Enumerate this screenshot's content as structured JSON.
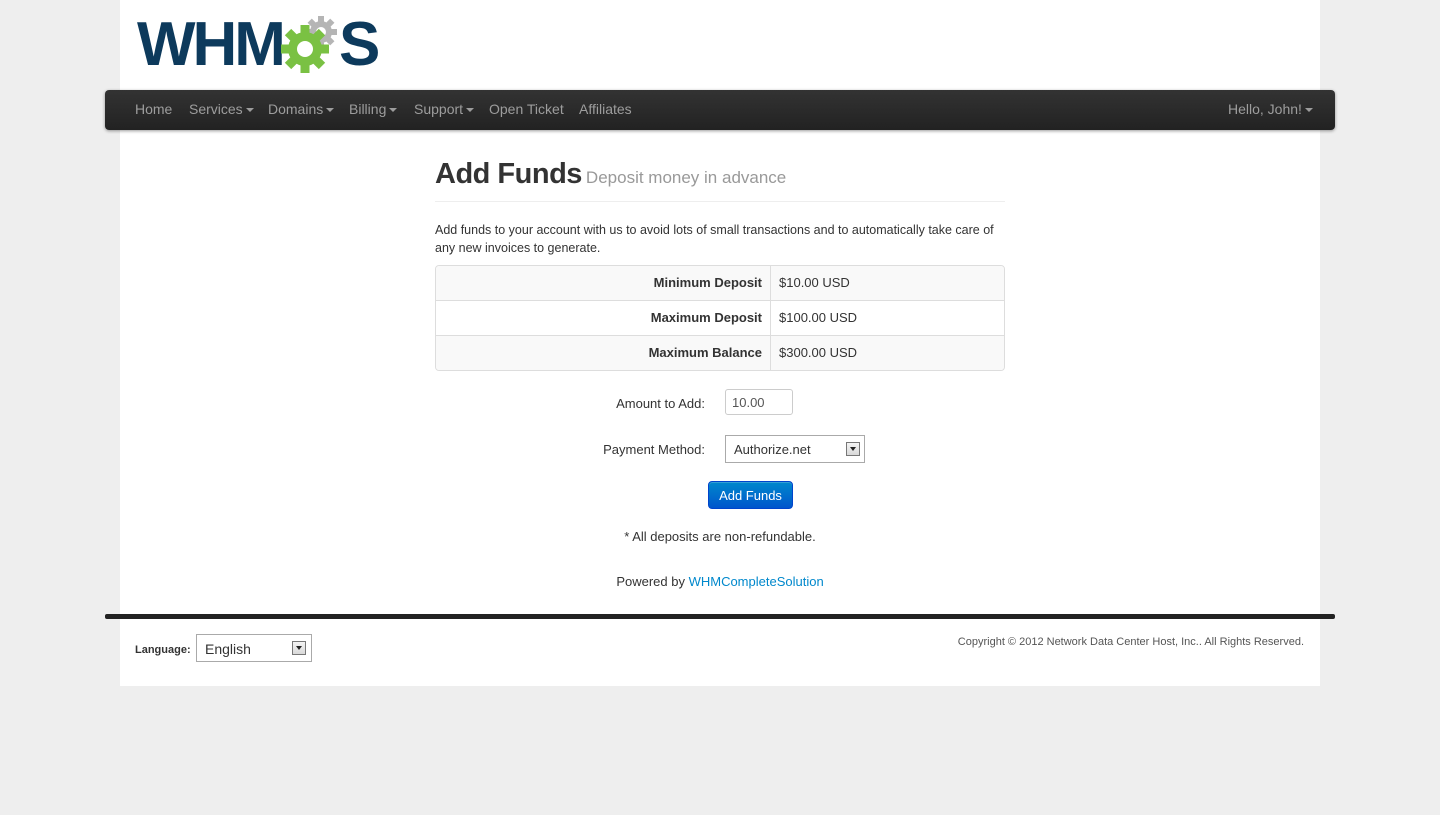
{
  "logo": {
    "text_before": "WHM",
    "text_after": "S",
    "alt": "WHMCS"
  },
  "nav": {
    "items": [
      {
        "label": "Home",
        "dropdown": false
      },
      {
        "label": "Services",
        "dropdown": true
      },
      {
        "label": "Domains",
        "dropdown": true
      },
      {
        "label": "Billing",
        "dropdown": true
      },
      {
        "label": "Support",
        "dropdown": true
      },
      {
        "label": "Open Ticket",
        "dropdown": false
      },
      {
        "label": "Affiliates",
        "dropdown": false
      }
    ],
    "user_menu": "Hello, John!"
  },
  "header": {
    "title": "Add Funds",
    "subtitle": "Deposit money in advance"
  },
  "intro": "Add funds to your account with us to avoid lots of small transactions and to automatically take care of any new invoices to generate.",
  "limits": [
    {
      "label": "Minimum Deposit",
      "value": "$10.00 USD"
    },
    {
      "label": "Maximum Deposit",
      "value": "$100.00 USD"
    },
    {
      "label": "Maximum Balance",
      "value": "$300.00 USD"
    }
  ],
  "form": {
    "amount_label": "Amount to Add:",
    "amount_value": "10.00",
    "payment_label": "Payment Method:",
    "payment_value": "Authorize.net",
    "submit_label": "Add Funds"
  },
  "note": "* All deposits are non-refundable.",
  "powered": {
    "prefix": "Powered by ",
    "link": "WHMCompleteSolution"
  },
  "footer": {
    "language_label": "Language:",
    "language_value": "English",
    "copyright": "Copyright © 2012 Network Data Center Host, Inc.. All Rights Reserved."
  },
  "colors": {
    "brand_navy": "#0d3a5c",
    "gear_green": "#7ac143",
    "gear_gray": "#b5b5b5",
    "primary_blue": "#0088cc"
  }
}
